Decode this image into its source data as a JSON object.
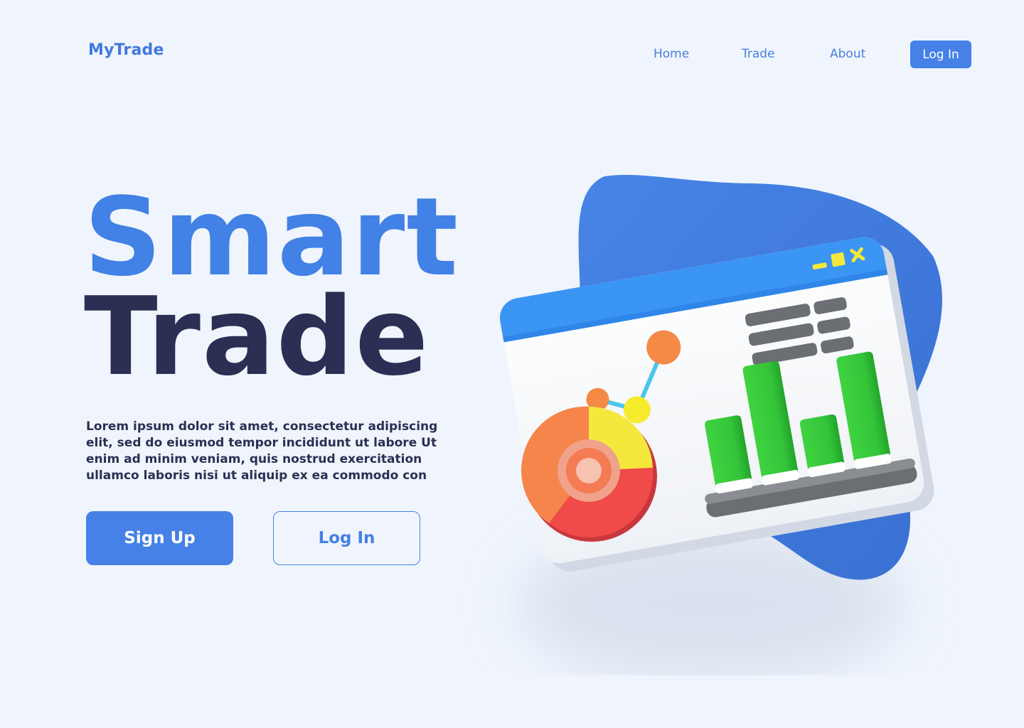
{
  "brand": {
    "name": "MyTrade"
  },
  "nav": {
    "items": [
      {
        "label": "Home"
      },
      {
        "label": "Trade"
      },
      {
        "label": "About"
      }
    ],
    "login_label": "Log In"
  },
  "hero": {
    "title_line1": "Smart",
    "title_line2": "Trade",
    "description": "Lorem ipsum dolor sit amet, consectetur adipiscing elit, sed do eiusmod tempor incididunt ut labore Ut enim ad minim veniam, quis nostrud exercitation ullamco laboris nisi ut aliquip ex ea commodo con",
    "signup_label": "Sign Up",
    "login_label": "Log In"
  },
  "colors": {
    "brand_blue": "#4581e6",
    "heading_dark": "#2b2f54",
    "background": "#f0f5fd",
    "blob": "#3f79dd"
  },
  "illustration": {
    "icons": [
      "minimize-icon",
      "maximize-icon",
      "close-icon"
    ]
  }
}
